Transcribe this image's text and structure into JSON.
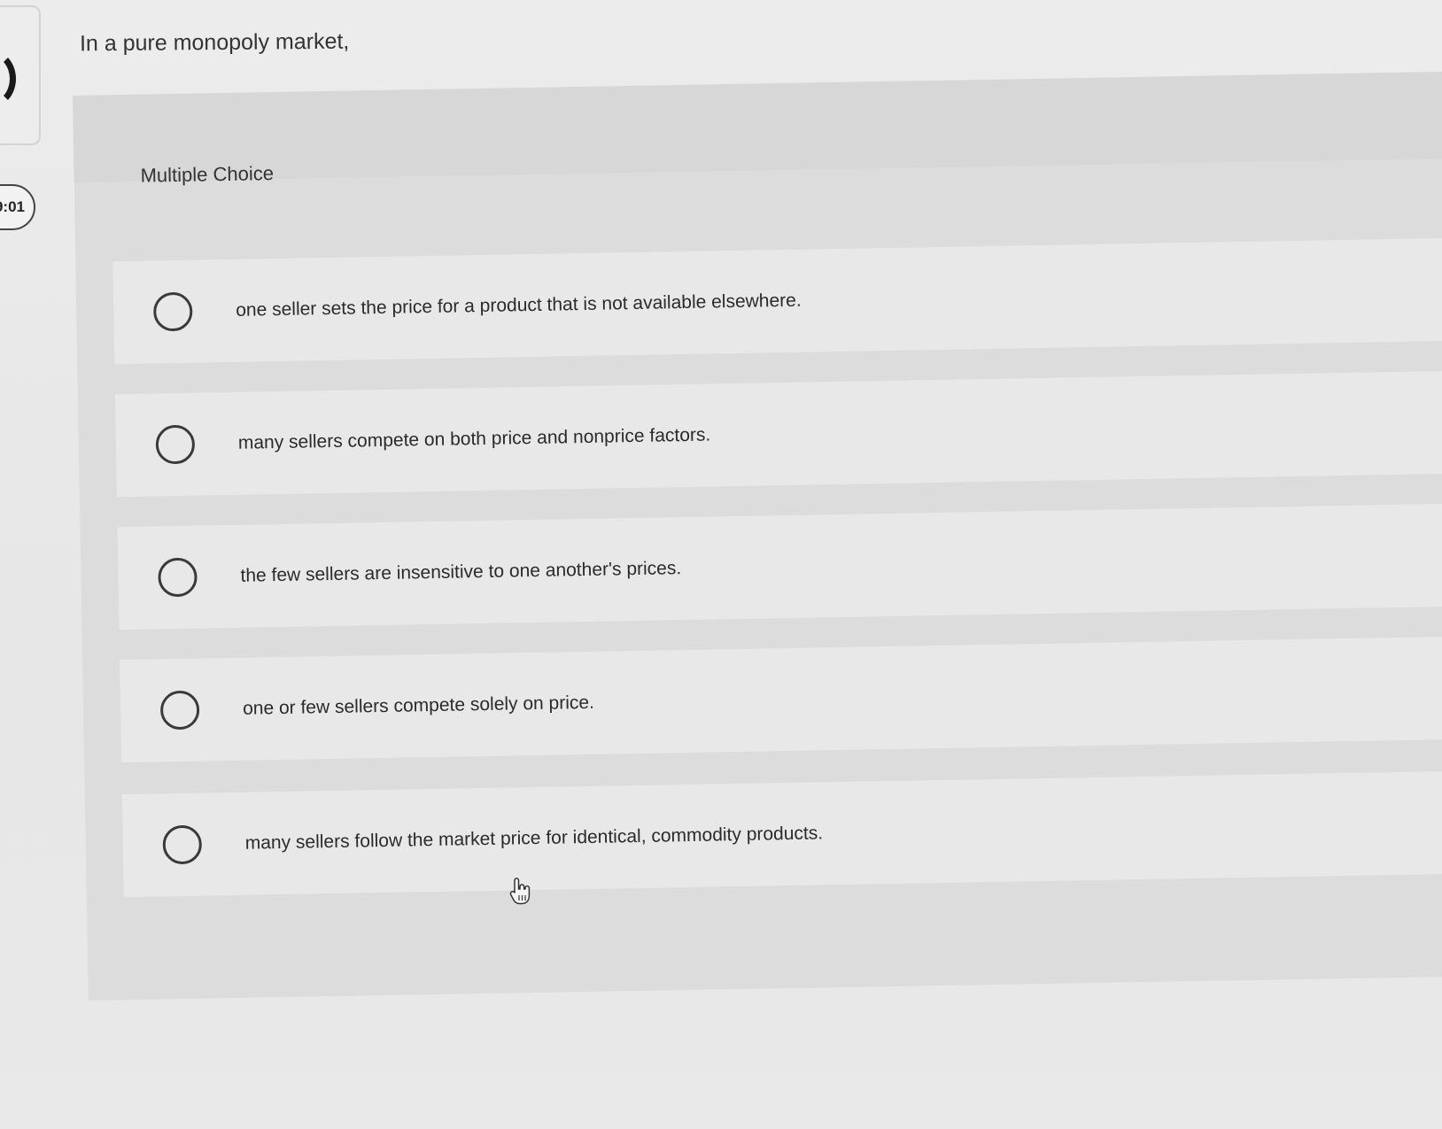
{
  "timer": {
    "text": "9:01"
  },
  "question": {
    "text": "In a pure monopoly market,"
  },
  "choice_section": {
    "label": "Multiple Choice",
    "options": [
      {
        "label": "one seller sets the price for a product that is not available elsewhere."
      },
      {
        "label": "many sellers compete on both price and nonprice factors."
      },
      {
        "label": "the few sellers are insensitive to one another's prices."
      },
      {
        "label": "one or few sellers compete solely on price."
      },
      {
        "label": "many sellers follow the market price for identical, commodity products."
      }
    ]
  },
  "icons": {
    "cursor": "hand-pointer-icon",
    "radio": "radio-unselected-icon"
  }
}
